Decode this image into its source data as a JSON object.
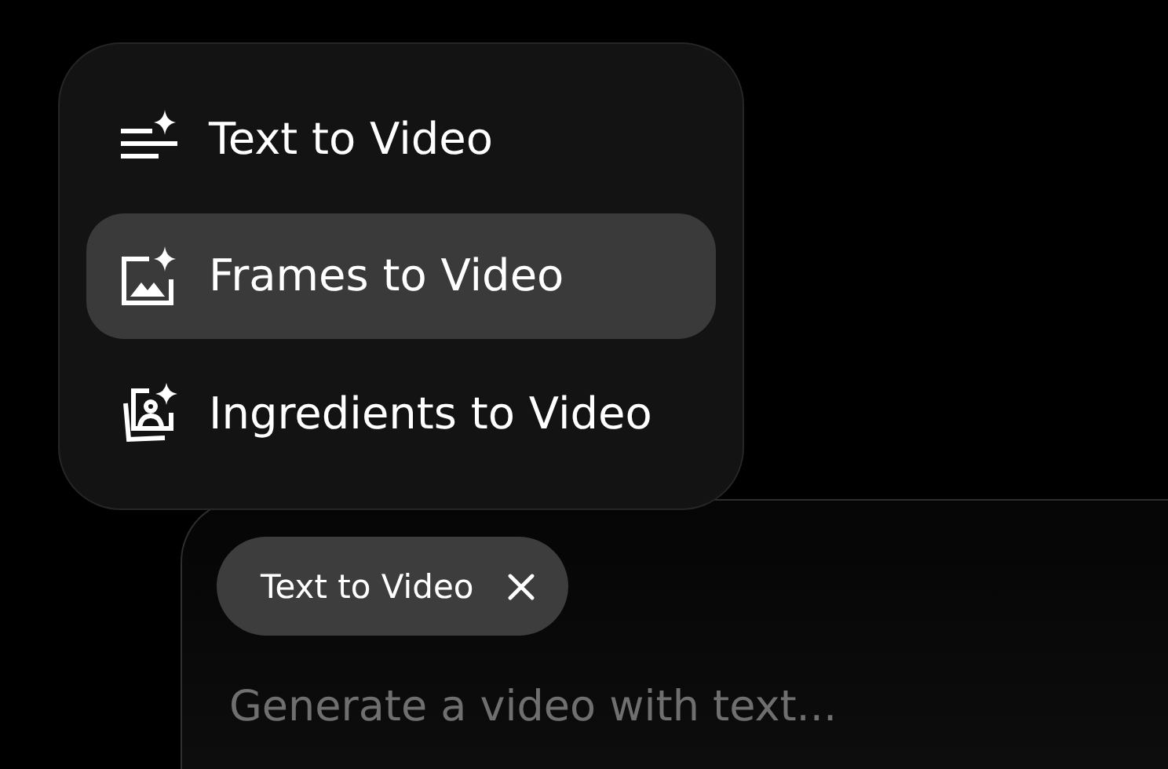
{
  "mode_menu": {
    "items": [
      {
        "kind": "text",
        "label": "Text to Video",
        "selected": false
      },
      {
        "kind": "frames",
        "label": "Frames to Video",
        "selected": true
      },
      {
        "kind": "ingredients",
        "label": "Ingredients to Video",
        "selected": false
      }
    ]
  },
  "prompt": {
    "chip": {
      "label": "Text to Video"
    },
    "placeholder": "Generate a video with text..."
  }
}
